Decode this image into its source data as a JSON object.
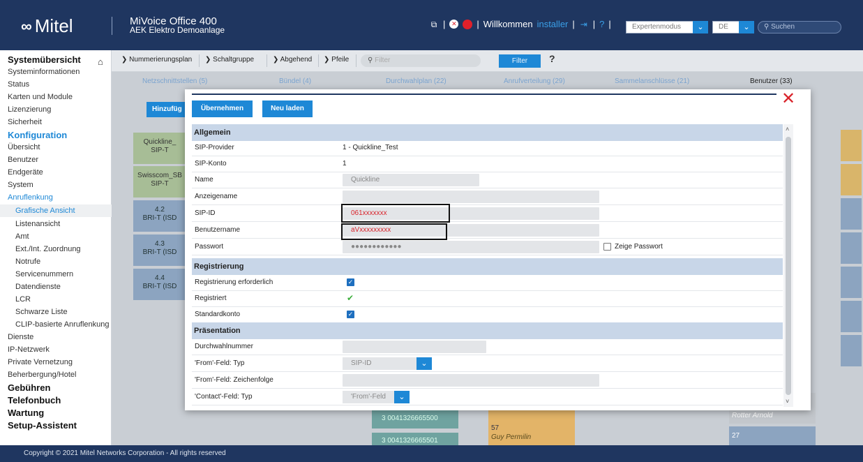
{
  "header": {
    "brand": "Mitel",
    "product_title": "MiVoice Office 400",
    "product_subtitle": "AEK Elektro Demoanlage",
    "welcome_label": "Willkommen",
    "user": "installer",
    "help": "?",
    "mode_select": "Expertenmodus",
    "lang_select": "DE",
    "search_placeholder": "Suchen"
  },
  "sidebar": {
    "items": [
      {
        "label": "Systemübersicht",
        "level": 0
      },
      {
        "label": "Systeminformationen",
        "level": 1
      },
      {
        "label": "Status",
        "level": 1
      },
      {
        "label": "Karten und Module",
        "level": 1
      },
      {
        "label": "Lizenzierung",
        "level": 1
      },
      {
        "label": "Sicherheit",
        "level": 1
      },
      {
        "label": "Konfiguration",
        "level": 0
      },
      {
        "label": "Übersicht",
        "level": 1
      },
      {
        "label": "Benutzer",
        "level": 1
      },
      {
        "label": "Endgeräte",
        "level": 1
      },
      {
        "label": "System",
        "level": 1
      },
      {
        "label": "Anruflenkung",
        "level": 1
      },
      {
        "label": "Grafische Ansicht",
        "level": 2
      },
      {
        "label": "Listenansicht",
        "level": 2
      },
      {
        "label": "Amt",
        "level": 2
      },
      {
        "label": "Ext./Int. Zuordnung",
        "level": 2
      },
      {
        "label": "Notrufe",
        "level": 2
      },
      {
        "label": "Servicenummern",
        "level": 2
      },
      {
        "label": "Datendienste",
        "level": 2
      },
      {
        "label": "LCR",
        "level": 2
      },
      {
        "label": "Schwarze Liste",
        "level": 2
      },
      {
        "label": "CLIP-basierte Anruflenkung",
        "level": 2
      },
      {
        "label": "Dienste",
        "level": 1
      },
      {
        "label": "IP-Netzwerk",
        "level": 1
      },
      {
        "label": "Private Vernetzung",
        "level": 1
      },
      {
        "label": "Beherbergung/Hotel",
        "level": 1
      },
      {
        "label": "Gebühren",
        "level": 0
      },
      {
        "label": "Telefonbuch",
        "level": 0
      },
      {
        "label": "Wartung",
        "level": 0
      },
      {
        "label": "Setup-Assistent",
        "level": 0
      }
    ]
  },
  "toolbar": {
    "buttons": [
      "Nummerierungsplan",
      "Schaltgruppe",
      "Abgehend",
      "Pfeile"
    ],
    "filter_placeholder": "Filter",
    "filter_button": "Filter",
    "help": "?"
  },
  "tabs": [
    "Netzschnittstellen (5)",
    "Bündel (4)",
    "Durchwahlplan (22)",
    "Anrufverteilung (29)",
    "Sammelanschlüsse (21)",
    "Benutzer (33)"
  ],
  "background": {
    "add_button": "Hinzufüg",
    "tiles": [
      {
        "line1": "Quickline_",
        "line2": "SIP-T"
      },
      {
        "line1": "Swisscom_SB",
        "line2": "SIP-T"
      },
      {
        "line1": "4.2",
        "line2": "BRI-T (ISD"
      },
      {
        "line1": "4.3",
        "line2": "BRI-T (ISD"
      },
      {
        "line1": "4.4",
        "line2": "BRI-T (ISD"
      }
    ],
    "bottom_items": [
      "3  0041326665500",
      "3  0041326665501",
      "57",
      "Guy Permilin",
      "Rotter Arnold",
      "27"
    ]
  },
  "modal": {
    "apply_button": "Übernehmen",
    "reload_button": "Neu laden",
    "sections": {
      "general": "Allgemein",
      "registration": "Registrierung",
      "presentation": "Präsentation"
    },
    "fields": {
      "sip_provider_label": "SIP-Provider",
      "sip_provider_value": "1 - Quickline_Test",
      "sip_account_label": "SIP-Konto",
      "sip_account_value": "1",
      "name_label": "Name",
      "name_value": "Quickline",
      "display_name_label": "Anzeigename",
      "display_name_value": "",
      "sip_id_label": "SIP-ID",
      "sip_id_value": "061xxxxxxx",
      "username_label": "Benutzername",
      "username_value": "aVxxxxxxxxx",
      "password_label": "Passwort",
      "password_value": "●●●●●●●●●●●●",
      "show_password_label": "Zeige Passwort",
      "reg_required_label": "Registrierung erforderlich",
      "registered_label": "Registriert",
      "default_account_label": "Standardkonto",
      "did_label": "Durchwahlnummer",
      "did_value": "",
      "from_type_label": "'From'-Feld: Typ",
      "from_type_value": "SIP-ID",
      "from_string_label": "'From'-Feld: Zeichenfolge",
      "from_string_value": "",
      "contact_type_label": "'Contact'-Feld: Typ",
      "contact_type_value": "'From'-Feld"
    }
  },
  "footer": {
    "copyright": "Copyright © 2021 Mitel Networks Corporation - All rights reserved"
  }
}
